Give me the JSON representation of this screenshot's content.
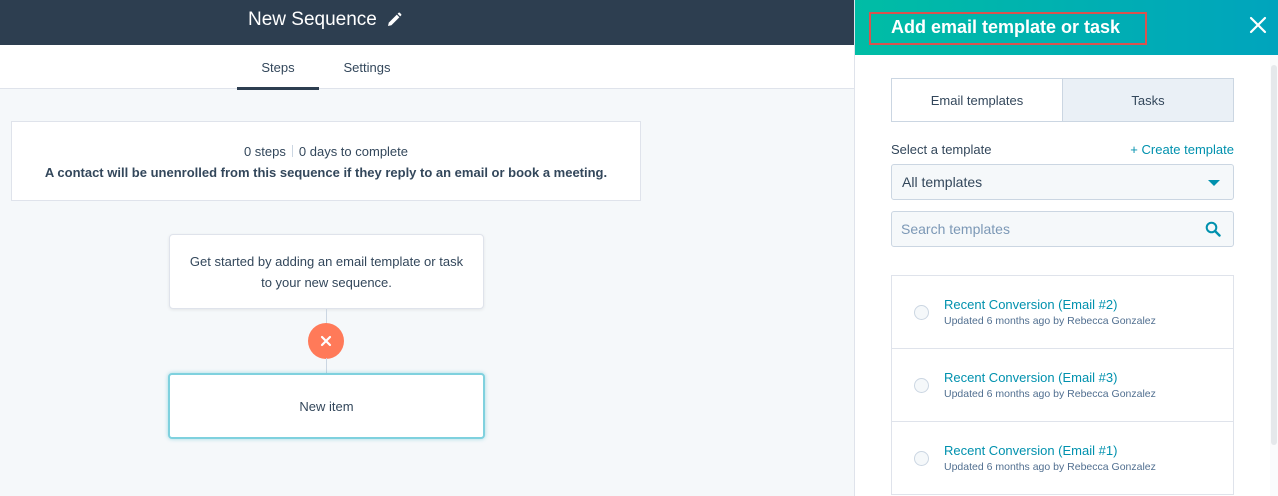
{
  "header": {
    "sequence_title": "New Sequence"
  },
  "tabs": [
    {
      "label": "Steps",
      "active": true
    },
    {
      "label": "Settings",
      "active": false
    }
  ],
  "summary": {
    "steps": "0 steps",
    "days": "0 days to complete",
    "note": "A contact will be unenrolled from this sequence if they reply to an email or book a meeting."
  },
  "flow": {
    "start_line1": "Get started by adding an email template or task",
    "start_line2": "to your new sequence.",
    "new_item_label": "New item"
  },
  "panel": {
    "title": "Add email template or task",
    "segment_tabs": [
      {
        "label": "Email templates",
        "active": true
      },
      {
        "label": "Tasks",
        "active": false
      }
    ],
    "select_label": "Select a template",
    "create_link": "+ Create template",
    "dropdown_value": "All templates",
    "search_placeholder": "Search templates",
    "templates": [
      {
        "name": "Recent Conversion (Email #2)",
        "meta": "Updated 6 months ago by Rebecca Gonzalez"
      },
      {
        "name": "Recent Conversion (Email #3)",
        "meta": "Updated 6 months ago by Rebecca Gonzalez"
      },
      {
        "name": "Recent Conversion (Email #1)",
        "meta": "Updated 6 months ago by Rebecca Gonzalez"
      }
    ]
  },
  "colors": {
    "topbar": "#2d3e50",
    "header_gradient_start": "#00bda5",
    "header_gradient_end": "#00a4bd",
    "link": "#0091ae",
    "remove_button": "#ff7a59",
    "highlight_border": "#d9534f"
  },
  "icons": {
    "edit": "pencil-icon",
    "remove": "close-icon",
    "panel_close": "close-icon",
    "search": "search-icon",
    "dropdown": "chevron-down-icon"
  }
}
